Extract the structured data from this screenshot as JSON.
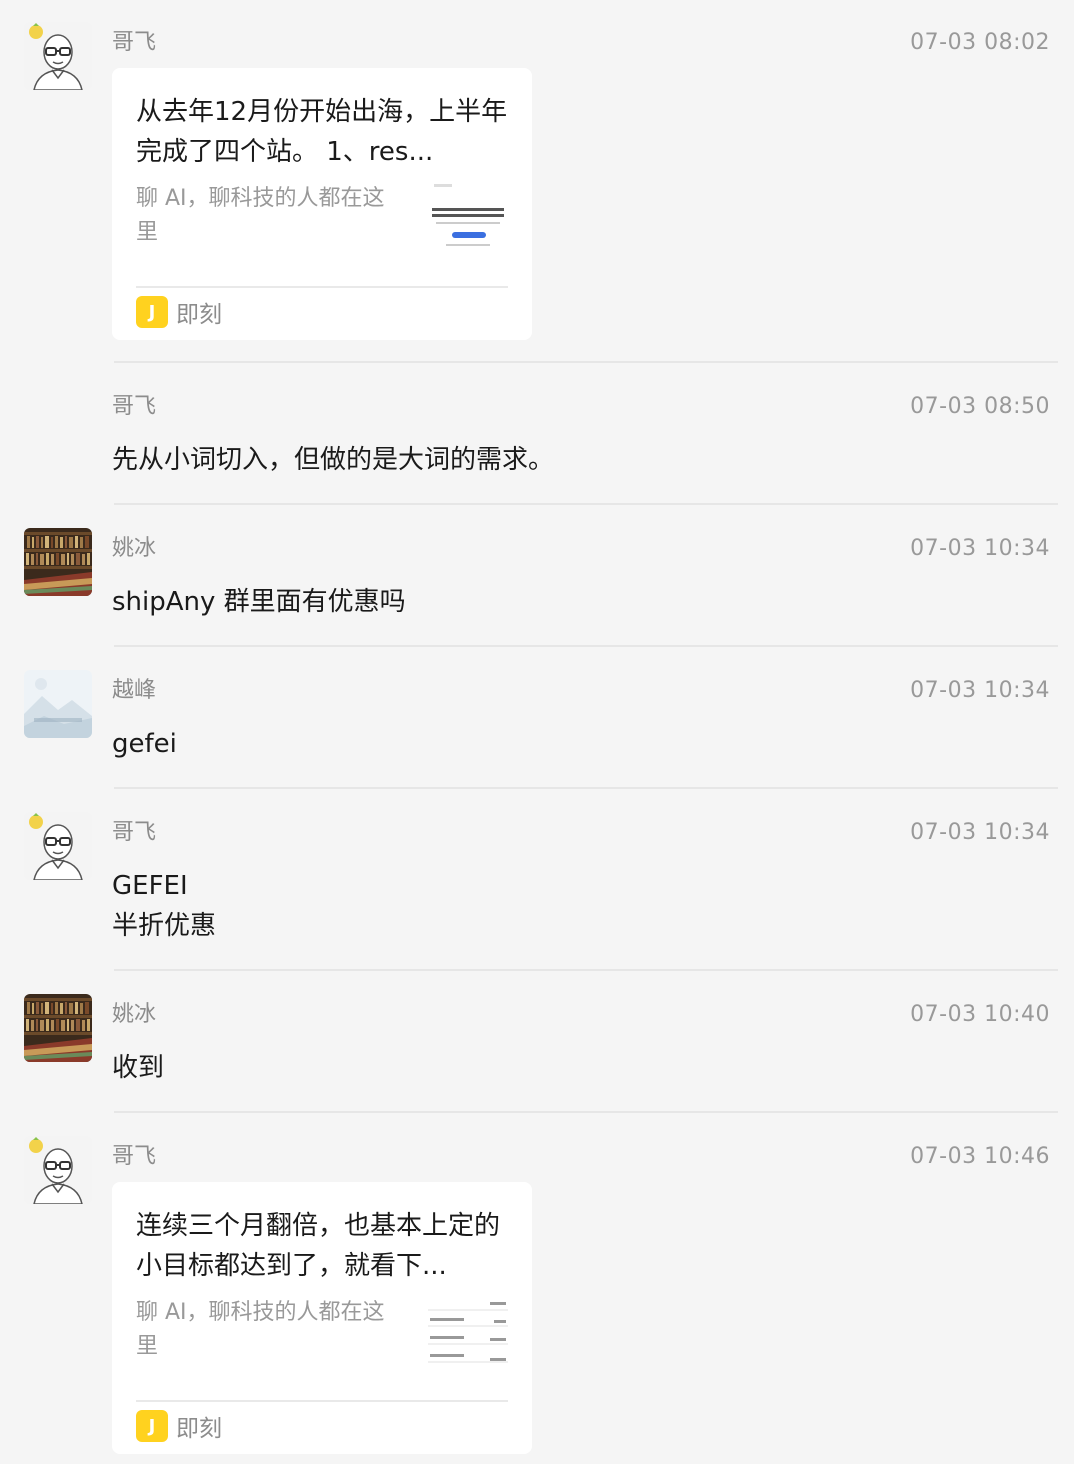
{
  "messages": [
    {
      "sender": "哥飞",
      "time": "07-03 08:02",
      "avatar_icon": "bald-glasses-avatar-icon",
      "card": {
        "title": "从去年12月份开始出海，上半年完成了四个站。 1、res...",
        "desc": "聊 AI，聊科技的人都在这里",
        "source_label": "即刻",
        "source_icon_letter": "J"
      }
    },
    {
      "sender": "哥飞",
      "time": "07-03 08:50",
      "text": "先从小词切入，但做的是大词的需求。"
    },
    {
      "sender": "姚冰",
      "time": "07-03 10:34",
      "avatar_icon": "bookshelf-avatar-icon",
      "text": "shipAny 群里面有优惠吗"
    },
    {
      "sender": "越峰",
      "time": "07-03 10:34",
      "avatar_icon": "landscape-placeholder-avatar-icon",
      "text": "gefei"
    },
    {
      "sender": "哥飞",
      "time": "07-03 10:34",
      "avatar_icon": "bald-glasses-avatar-icon",
      "text_lines": [
        "GEFEI",
        "半折优惠"
      ]
    },
    {
      "sender": "姚冰",
      "time": "07-03 10:40",
      "avatar_icon": "bookshelf-avatar-icon",
      "text": "收到"
    },
    {
      "sender": "哥飞",
      "time": "07-03 10:46",
      "avatar_icon": "bald-glasses-avatar-icon",
      "card": {
        "title": "连续三个月翻倍，也基本上定的小目标都达到了，就看下...",
        "desc": "聊 AI，聊科技的人都在这里",
        "source_label": "即刻",
        "source_icon_letter": "J"
      }
    }
  ],
  "colors": {
    "background": "#f5f5f5",
    "card": "#ffffff",
    "jike_yellow": "#ffd21f",
    "meta_gray": "#999999"
  }
}
